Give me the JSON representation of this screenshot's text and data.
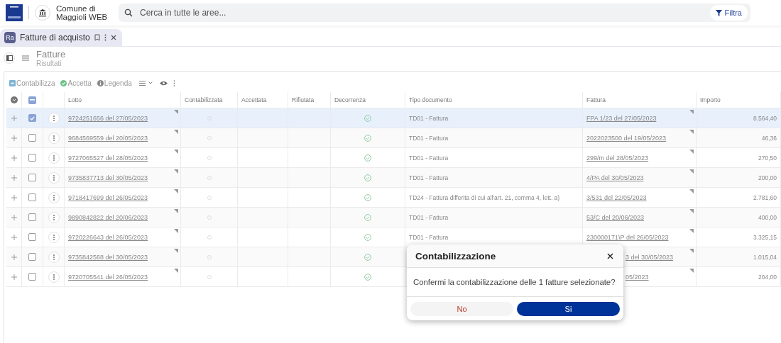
{
  "app": {
    "org_line1": "Comune di",
    "org_line2": "Maggioli WEB"
  },
  "search": {
    "placeholder": "Cerca in tutte le aree...",
    "filter_label": "Filtra"
  },
  "tabs": [
    {
      "badge": "Ra",
      "label": "Fatture di acquisto",
      "selected": true
    }
  ],
  "header": {
    "title": "Fatture",
    "subtitle": "Risultati"
  },
  "toolbar": [
    {
      "kind": "contabilizza",
      "label": "Contabilizza"
    },
    {
      "kind": "accetta",
      "label": "Accetta"
    },
    {
      "kind": "legenda",
      "label": "Legenda"
    }
  ],
  "table": {
    "select_all_indeterminate": true,
    "columns": [
      "Lotto",
      "Contabilizzata",
      "Accettata",
      "Rifiutata",
      "Decorrenza",
      "Tipo documento",
      "Fattura",
      "Importo"
    ],
    "rows": [
      {
        "lotto": "9724251656 del 27/05/2023",
        "tipo": "TD01 - Fattura",
        "fattura": "FPA 1/23 del 27/05/2023",
        "importo": "8.564,40",
        "selected": true,
        "checked": true,
        "covered": false
      },
      {
        "lotto": "9684569559 del 20/05/2023",
        "tipo": "TD01 - Fattura",
        "fattura": "2022023500 del 19/05/2023",
        "importo": "46,36",
        "selected": false,
        "checked": false,
        "covered": false
      },
      {
        "lotto": "9727065527 del 28/05/2023",
        "tipo": "TD01 - Fattura",
        "fattura": "299/m del 28/05/2023",
        "importo": "270,50",
        "selected": false,
        "checked": false,
        "covered": false
      },
      {
        "lotto": "9735837713 del 30/05/2023",
        "tipo": "TD01 - Fattura",
        "fattura": "4/PA del 30/05/2023",
        "importo": "200,00",
        "selected": false,
        "checked": false,
        "covered": false
      },
      {
        "lotto": "9718417699 del 26/05/2023",
        "tipo": "TD24 - Fattura differita di cui all'art. 21, comma 4, lett. a)",
        "fattura": "3/531 del 22/05/2023",
        "importo": "2.781,60",
        "selected": false,
        "checked": false,
        "covered": false
      },
      {
        "lotto": "9890842822 del 20/06/2023",
        "tipo": "TD01 - Fattura",
        "fattura": "53/C del 20/06/2023",
        "importo": "400,00",
        "selected": false,
        "checked": false,
        "covered": false
      },
      {
        "lotto": "9720226643 del 26/05/2023",
        "tipo": "TD01 - Fattura",
        "fattura": "230000171\\P del 26/05/2023",
        "importo": "3.325,15",
        "selected": false,
        "checked": false,
        "covered": false
      },
      {
        "lotto": "9735842568 del 30/05/2023",
        "fattura": "3 del 30/05/2023",
        "importo": "1.015,04",
        "selected": false,
        "checked": false,
        "covered": true
      },
      {
        "lotto": "9720705541 del 26/05/2023",
        "fattura": "05/2023",
        "importo": "204,00",
        "selected": false,
        "checked": false,
        "covered": true
      }
    ]
  },
  "dialog": {
    "title": "Contabilizzazione",
    "message": "Confermi la contabilizzazione delle 1 fatture selezionate?",
    "buttons": [
      {
        "kind": "secondary",
        "label": "No"
      },
      {
        "kind": "primary",
        "label": "Si"
      }
    ]
  }
}
